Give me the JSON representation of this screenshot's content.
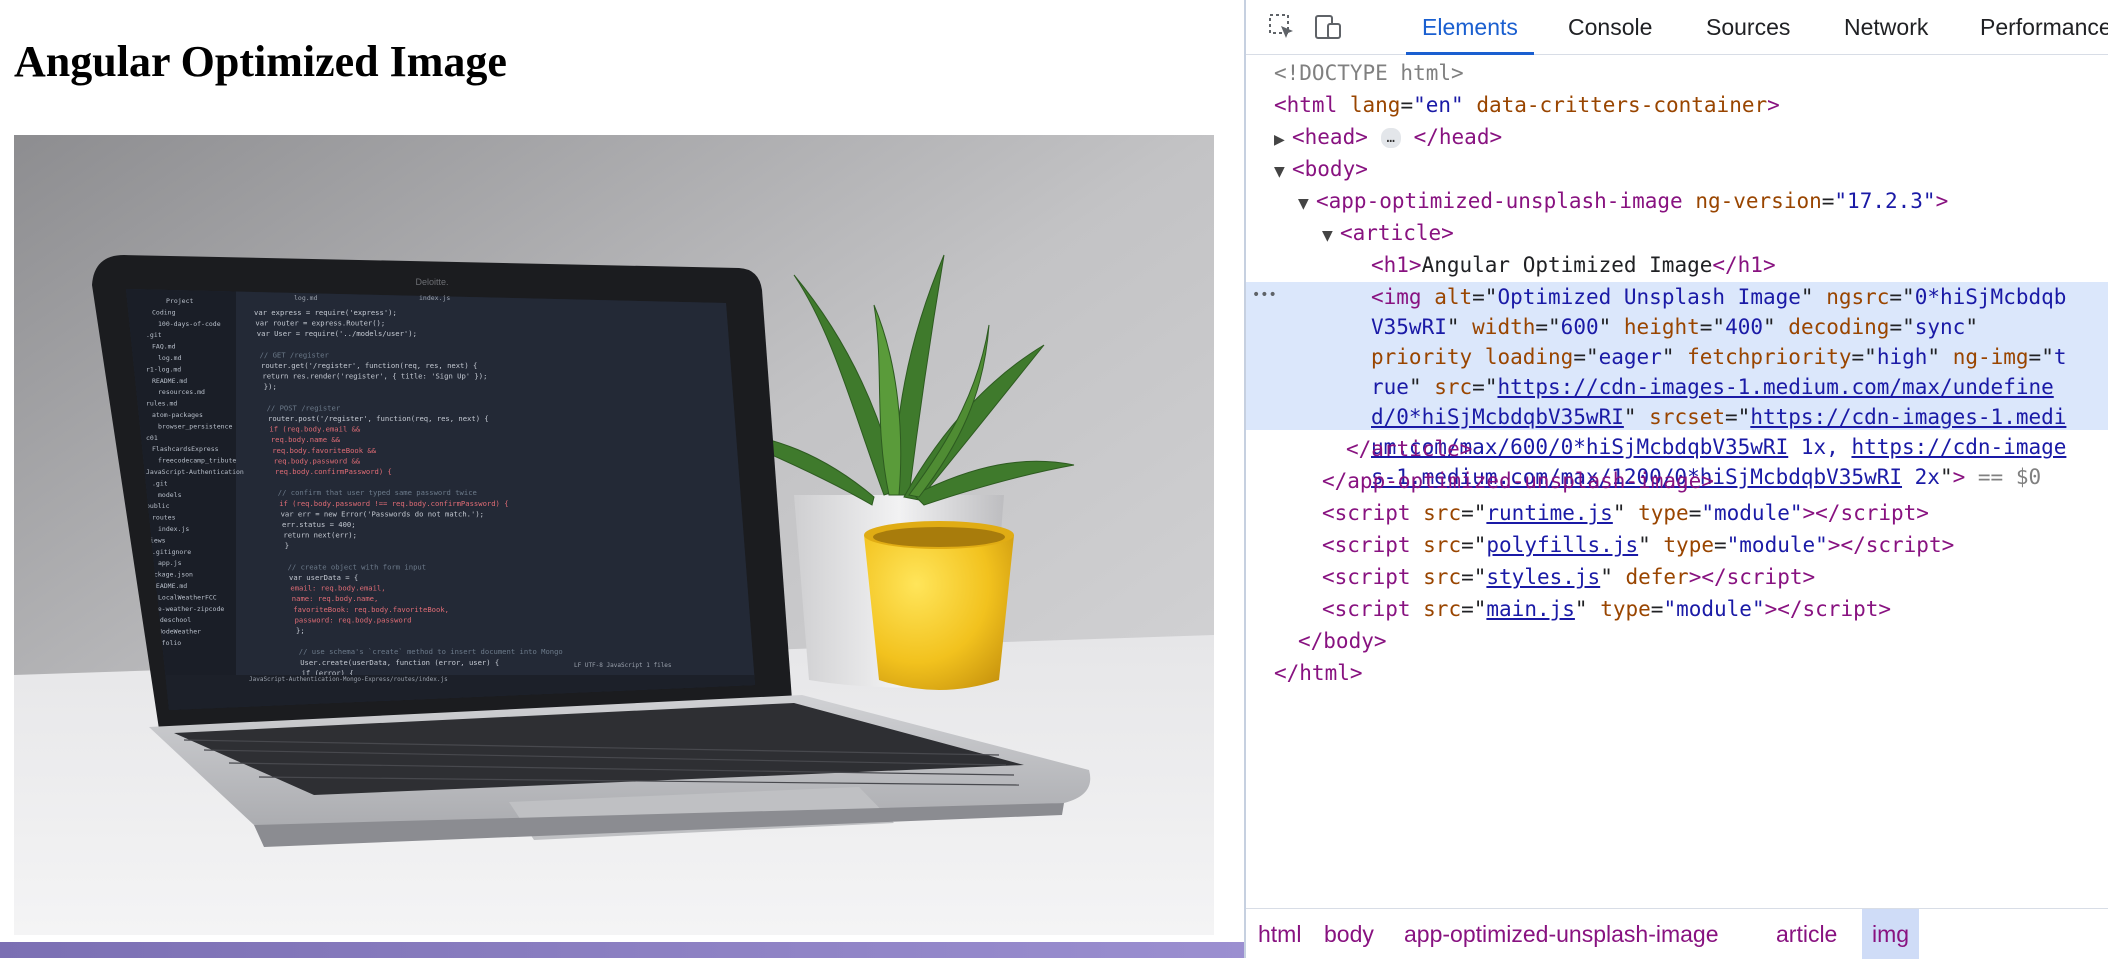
{
  "page": {
    "heading": "Angular Optimized Image",
    "image_alt": "Optimized Unsplash Image"
  },
  "devtools": {
    "tabs": [
      {
        "label": "Elements",
        "active": true
      },
      {
        "label": "Console",
        "active": false
      },
      {
        "label": "Sources",
        "active": false
      },
      {
        "label": "Network",
        "active": false
      },
      {
        "label": "Performance",
        "active": false
      }
    ],
    "icons": {
      "inspect": "inspect-element-icon",
      "device": "device-toolbar-icon"
    },
    "dom": {
      "doctype": "<!DOCTYPE html>",
      "html_open": "<html",
      "html_attr_lang": "lang",
      "html_val_lang": "\"en\"",
      "html_attr_critters": "data-critters-container",
      "head": "<head>",
      "head_close": "</head>",
      "ellipsis": "…",
      "body_open": "<body>",
      "app_open": "<app-optimized-unsplash-image",
      "app_attr": "ng-version",
      "app_val": "\"17.2.3\"",
      "article_open": "<article>",
      "h1_open": "<h1>",
      "h1_text": "Angular Optimized Image",
      "h1_close": "</h1>",
      "img_lines": [
        {
          "parts": [
            [
              "tag",
              "<img "
            ],
            [
              "attr",
              "alt"
            ],
            [
              "txt",
              "=\""
            ],
            [
              "val",
              "Optimized Unsplash Image"
            ],
            [
              "txt",
              "\" "
            ],
            [
              "attr",
              "ngsrc"
            ],
            [
              "txt",
              "=\""
            ],
            [
              "val",
              "0*hiSjMcbdqb"
            ]
          ]
        },
        {
          "parts": [
            [
              "val",
              "V35wRI"
            ],
            [
              "txt",
              "\" "
            ],
            [
              "attr",
              "width"
            ],
            [
              "txt",
              "=\""
            ],
            [
              "val",
              "600"
            ],
            [
              "txt",
              "\" "
            ],
            [
              "attr",
              "height"
            ],
            [
              "txt",
              "=\""
            ],
            [
              "val",
              "400"
            ],
            [
              "txt",
              "\" "
            ],
            [
              "attr",
              "decoding"
            ],
            [
              "txt",
              "=\""
            ],
            [
              "val",
              "sync"
            ],
            [
              "txt",
              "\""
            ]
          ]
        },
        {
          "parts": [
            [
              "attr",
              "priority"
            ],
            [
              "txt",
              " "
            ],
            [
              "attr",
              "loading"
            ],
            [
              "txt",
              "=\""
            ],
            [
              "val",
              "eager"
            ],
            [
              "txt",
              "\" "
            ],
            [
              "attr",
              "fetchpriority"
            ],
            [
              "txt",
              "=\""
            ],
            [
              "val",
              "high"
            ],
            [
              "txt",
              "\" "
            ],
            [
              "attr",
              "ng-img"
            ],
            [
              "txt",
              "=\""
            ],
            [
              "val",
              "t"
            ]
          ]
        },
        {
          "parts": [
            [
              "val",
              "rue"
            ],
            [
              "txt",
              "\" "
            ],
            [
              "attr",
              "src"
            ],
            [
              "txt",
              "=\""
            ],
            [
              "lnk",
              "https://cdn-images-1.medium.com/max/undefine"
            ]
          ]
        },
        {
          "parts": [
            [
              "lnk",
              "d/0*hiSjMcbdqbV35wRI"
            ],
            [
              "txt",
              "\" "
            ],
            [
              "attr",
              "srcset"
            ],
            [
              "txt",
              "=\""
            ],
            [
              "lnk",
              "https://cdn-images-1.medi"
            ]
          ]
        },
        {
          "parts": [
            [
              "lnk",
              "um.com/max/600/0*hiSjMcbdqbV35wRI"
            ],
            [
              "val",
              " 1x, "
            ],
            [
              "lnk",
              "https://cdn-image"
            ]
          ]
        },
        {
          "parts": [
            [
              "lnk",
              "s-1.medium.com/max/1200/0*hiSjMcbdqbV35wRI"
            ],
            [
              "val",
              " 2x"
            ],
            [
              "txt",
              "\""
            ],
            [
              "tag",
              ">"
            ],
            [
              "cmt",
              " == $0"
            ]
          ]
        }
      ],
      "article_close": "</article>",
      "app_close": "</app-optimized-unsplash-image>",
      "scripts": [
        {
          "src": "runtime.js",
          "extra_attr": "type",
          "extra_val": "\"module\""
        },
        {
          "src": "polyfills.js",
          "extra_attr": "type",
          "extra_val": "\"module\""
        },
        {
          "src": "styles.js",
          "extra_attr": "defer",
          "extra_val": ""
        },
        {
          "src": "main.js",
          "extra_attr": "type",
          "extra_val": "\"module\""
        }
      ],
      "body_close": "</body>",
      "html_close": "</html>",
      "row_dots": "•••"
    },
    "breadcrumbs": [
      {
        "label": "html",
        "active": false
      },
      {
        "label": "body",
        "active": false
      },
      {
        "label": "app-optimized-unsplash-image",
        "active": false
      },
      {
        "label": "article",
        "active": false
      },
      {
        "label": "img",
        "active": true
      }
    ]
  },
  "photo_code_lines": [
    "var express = require('express');",
    "var router = express.Router();",
    "var User = require('../models/user');",
    "",
    "// GET /register",
    "router.get('/register', function(req, res, next) {",
    "  return res.render('register', { title: 'Sign Up' });",
    "});",
    "",
    "// POST /register",
    "router.post('/register', function(req, res, next) {",
    "  if (req.body.email &&",
    "    req.body.name &&",
    "    req.body.favoriteBook &&",
    "    req.body.password &&",
    "    req.body.confirmPassword) {",
    "",
    "    // confirm that user typed same password twice",
    "    if (req.body.password !== req.body.confirmPassword) {",
    "      var err = new Error('Passwords do not match.');",
    "      err.status = 400;",
    "      return next(err);",
    "    }",
    "",
    "    // create object with form input",
    "    var userData = {",
    "      email: req.body.email,",
    "      name: req.body.name,",
    "      favoriteBook: req.body.favoriteBook,",
    "      password: req.body.password",
    "    };",
    "",
    "    // use schema's `create` method to insert document into Mongo",
    "    User.create(userData, function (error, user) {",
    "      if (error) {",
    "        return next(error);"
  ],
  "photo_sidebar_items": [
    "Project",
    "Coding",
    "100-days-of-code",
    ".git",
    "FAQ.md",
    "log.md",
    "r1-log.md",
    "README.md",
    "resources.md",
    "rules.md",
    "atom-packages",
    "browser_persistence",
    "c01",
    "FlashcardsExpress",
    "freecodecamp_tribute",
    "JavaScript-Authentication",
    ".git",
    "models",
    "public",
    "routes",
    "index.js",
    "views",
    ".gitignore",
    "app.js",
    "package.json",
    "README.md",
    "LocalWeatherFCC",
    "node-weather-zipcode",
    "nodeschool",
    "NodeWeather",
    "portfolio"
  ],
  "photo_bezel_label": "Deloitte.",
  "photo_tab_labels": [
    "log.md",
    "index.js"
  ],
  "photo_status_path": "JavaScript-Authentication-Mongo-Express/routes/index.js",
  "photo_status_right": [
    "LF",
    "UTF-8",
    "JavaScript",
    "1 files"
  ]
}
